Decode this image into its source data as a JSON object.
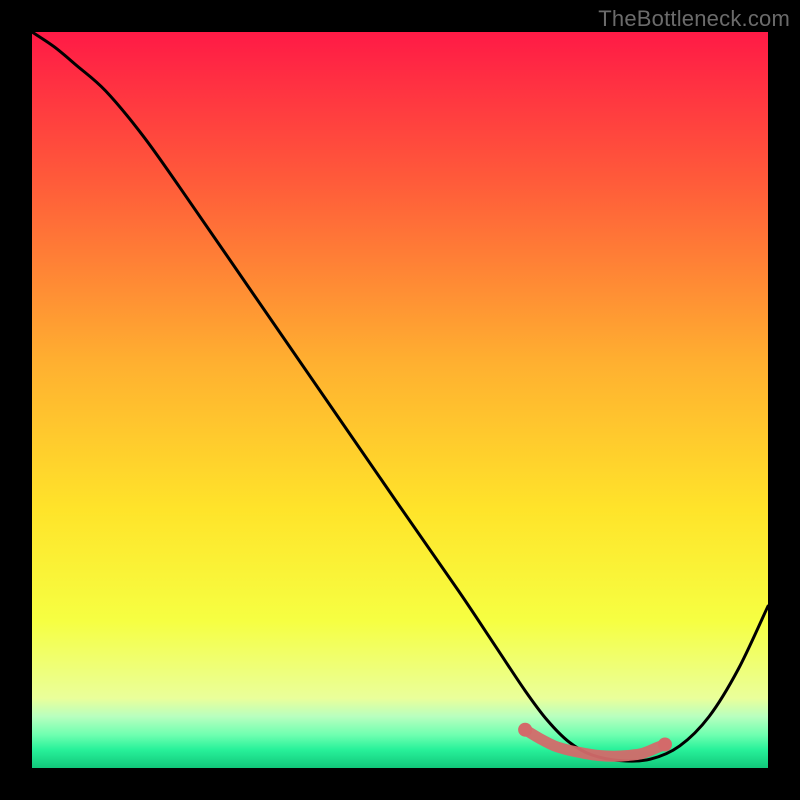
{
  "watermark": "TheBottleneck.com",
  "chart_data": {
    "type": "line",
    "title": "",
    "xlabel": "",
    "ylabel": "",
    "xlim": [
      0,
      100
    ],
    "ylim": [
      0,
      100
    ],
    "grid": false,
    "legend": false,
    "gradient_stops": [
      {
        "offset": 0.0,
        "color": "#ff1a46"
      },
      {
        "offset": 0.2,
        "color": "#ff5a3a"
      },
      {
        "offset": 0.45,
        "color": "#ffb030"
      },
      {
        "offset": 0.65,
        "color": "#ffe42a"
      },
      {
        "offset": 0.8,
        "color": "#f6ff42"
      },
      {
        "offset": 0.905,
        "color": "#eaff9a"
      },
      {
        "offset": 0.93,
        "color": "#b8ffbf"
      },
      {
        "offset": 0.955,
        "color": "#6fffb0"
      },
      {
        "offset": 0.975,
        "color": "#28f19a"
      },
      {
        "offset": 1.0,
        "color": "#11c77a"
      }
    ],
    "series": [
      {
        "name": "bottleneck-curve",
        "color": "#000000",
        "x": [
          0,
          3,
          6,
          10,
          15,
          20,
          30,
          40,
          50,
          58,
          63,
          67,
          70,
          73,
          76,
          80,
          84,
          88,
          92,
          96,
          100
        ],
        "y": [
          100,
          98,
          95.5,
          92,
          86,
          79,
          64.5,
          50,
          35.5,
          24,
          16.5,
          10.5,
          6.5,
          3.5,
          1.8,
          1.0,
          1.2,
          3.0,
          7.0,
          13.5,
          22
        ]
      }
    ],
    "highlight": {
      "name": "optimal-range",
      "color": "#d36a6a",
      "x_range": [
        67,
        86
      ],
      "points_x": [
        67,
        69,
        71,
        73,
        75,
        77,
        79,
        81,
        83,
        85,
        86
      ],
      "points_y": [
        5.2,
        4.0,
        3.0,
        2.4,
        2.0,
        1.7,
        1.6,
        1.7,
        2.0,
        2.8,
        3.2
      ]
    }
  }
}
